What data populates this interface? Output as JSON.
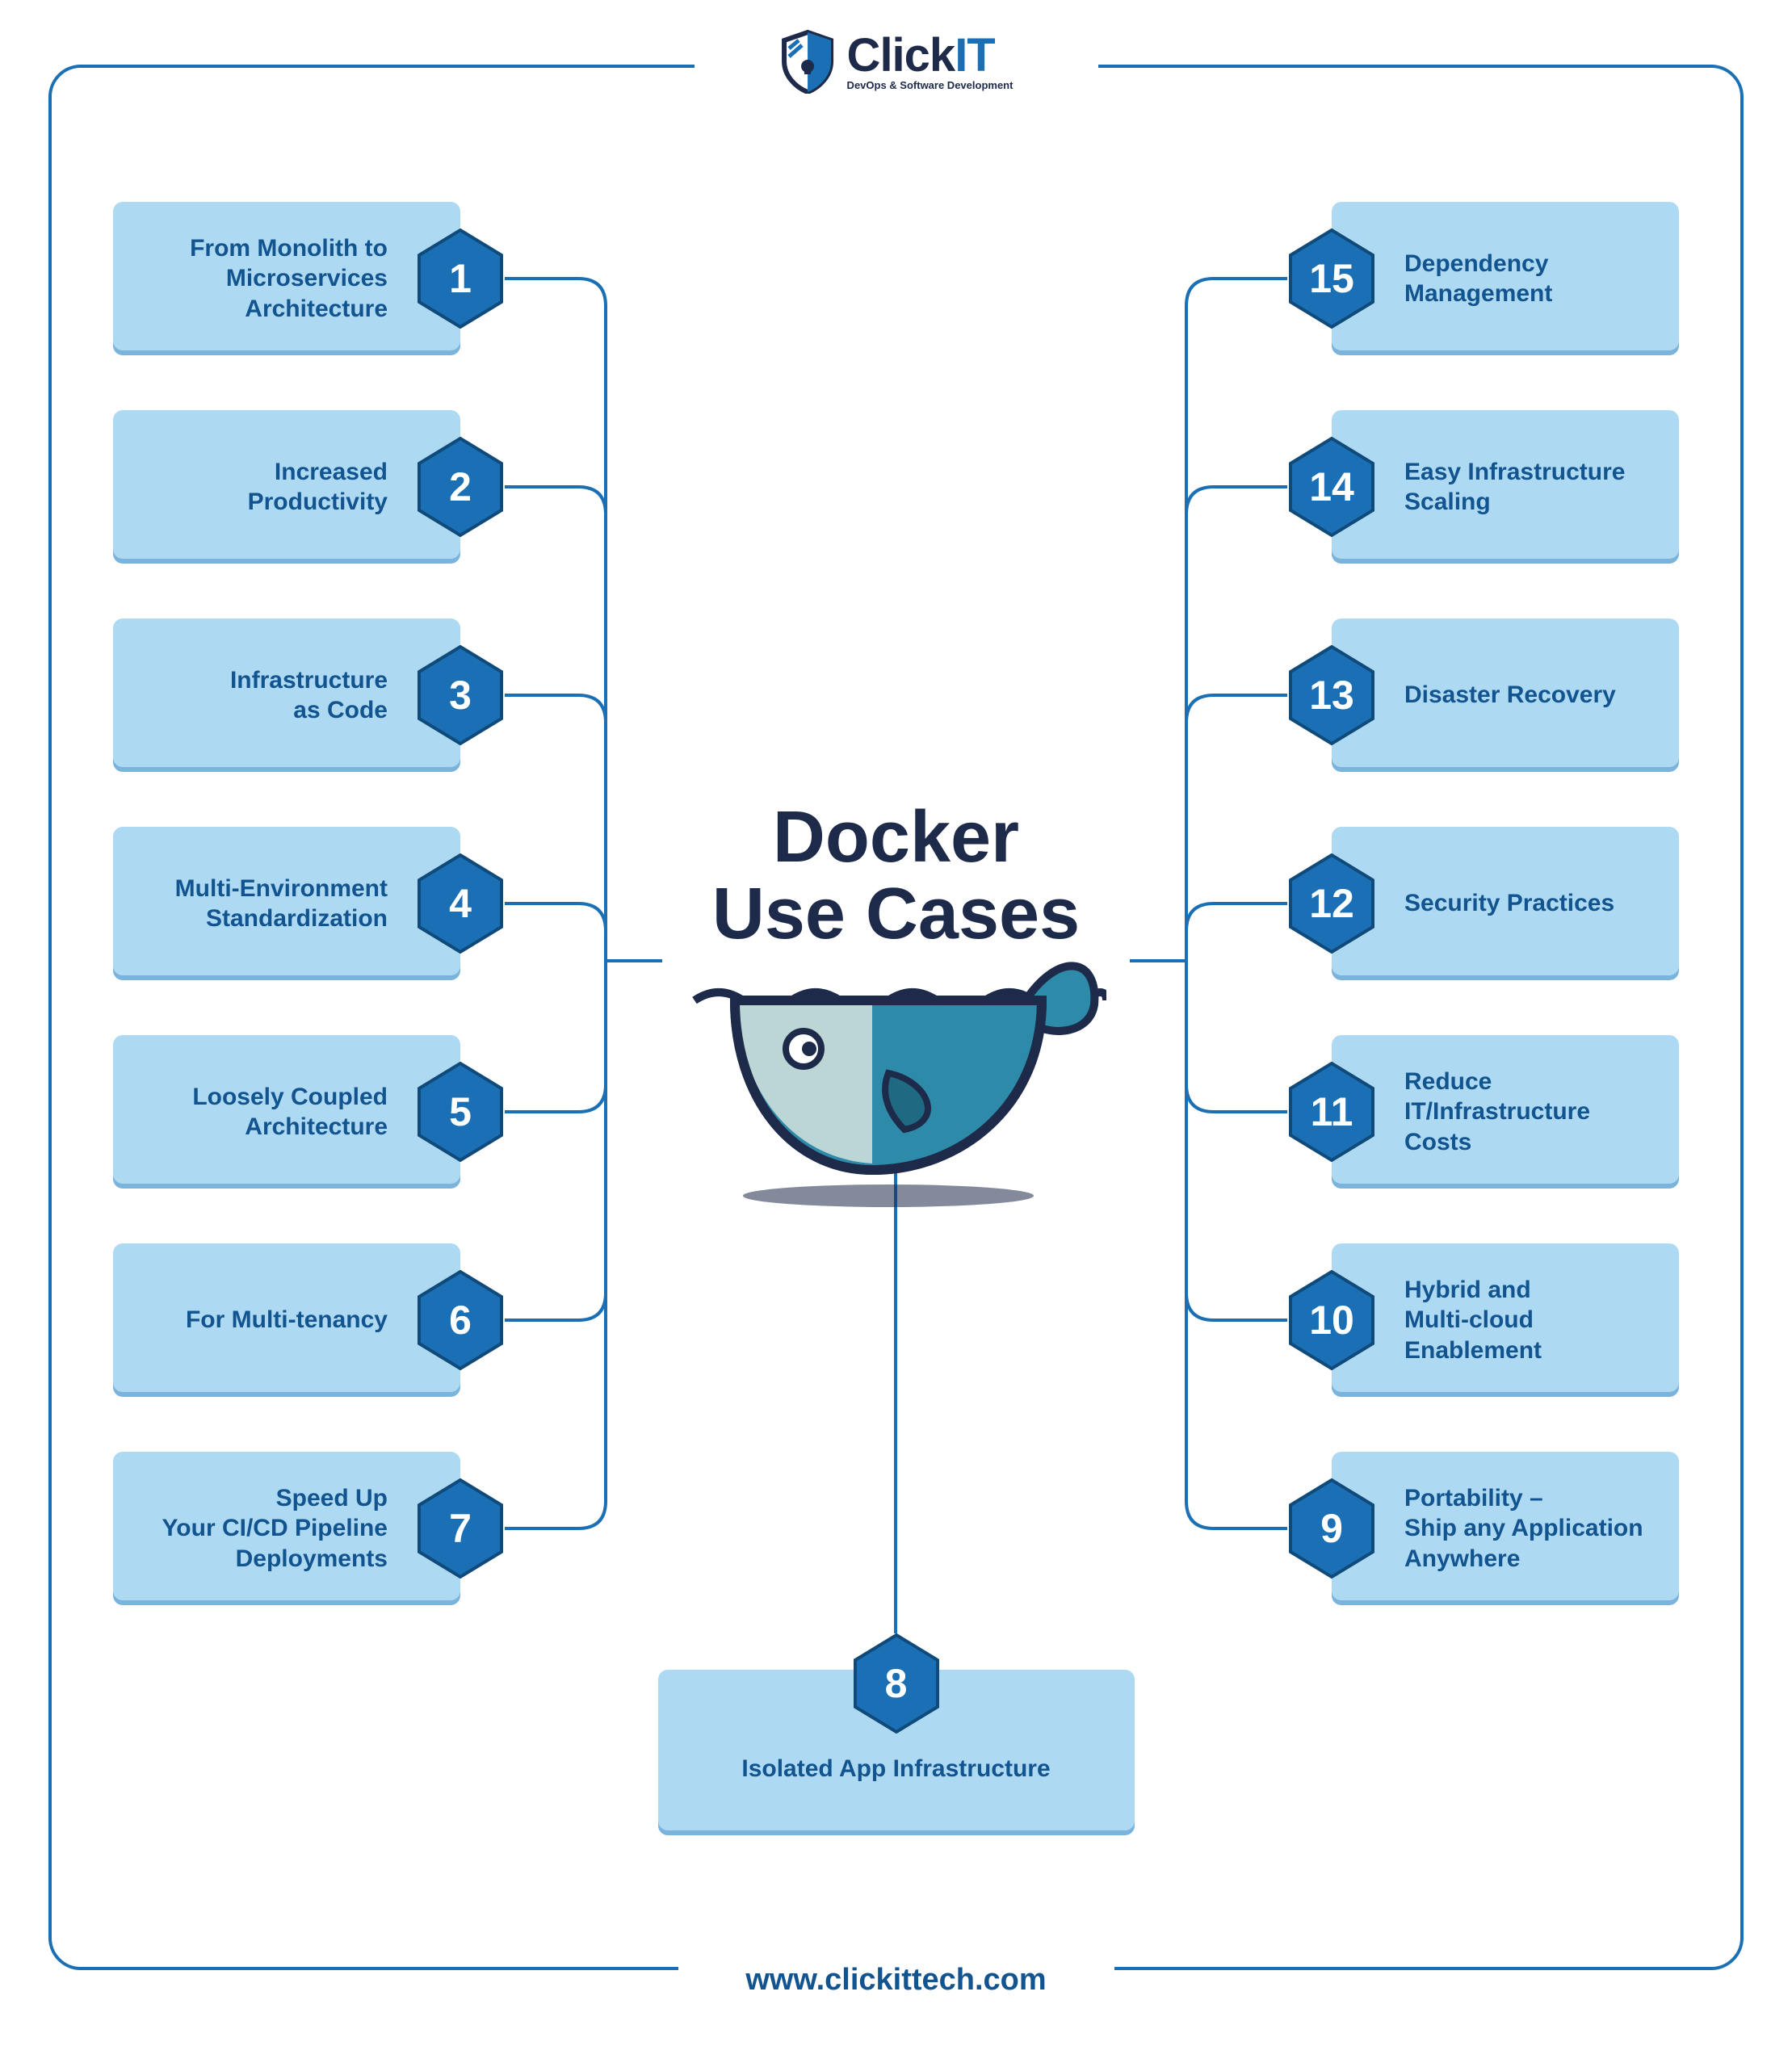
{
  "brand": {
    "name_part1": "Click",
    "name_part2": "IT",
    "tagline": "DevOps & Software Development"
  },
  "title_line1": "Docker",
  "title_line2": "Use Cases",
  "footer_url": "www.clickittech.com",
  "colors": {
    "frame": "#1a6fb5",
    "card_bg": "#aed9f2",
    "text_dark": "#1e2a4a",
    "text_card": "#11548f",
    "hex_fill": "#1a6fb5"
  },
  "left_items": [
    {
      "num": "1",
      "label": "From Monolith to\nMicroservices\nArchitecture"
    },
    {
      "num": "2",
      "label": "Increased\nProductivity"
    },
    {
      "num": "3",
      "label": "Infrastructure\nas Code"
    },
    {
      "num": "4",
      "label": "Multi-Environment\nStandardization"
    },
    {
      "num": "5",
      "label": "Loosely Coupled\nArchitecture"
    },
    {
      "num": "6",
      "label": "For Multi-tenancy"
    },
    {
      "num": "7",
      "label": "Speed Up\nYour CI/CD Pipeline\nDeployments"
    }
  ],
  "right_items": [
    {
      "num": "15",
      "label": "Dependency\nManagement"
    },
    {
      "num": "14",
      "label": "Easy Infrastructure\nScaling"
    },
    {
      "num": "13",
      "label": "Disaster Recovery"
    },
    {
      "num": "12",
      "label": "Security Practices"
    },
    {
      "num": "11",
      "label": "Reduce IT/Infrastructure\nCosts"
    },
    {
      "num": "10",
      "label": "Hybrid and\nMulti-cloud Enablement"
    },
    {
      "num": "9",
      "label": "Portability –\nShip any Application\nAnywhere"
    }
  ],
  "bottom_item": {
    "num": "8",
    "label": "Isolated App Infrastructure"
  }
}
